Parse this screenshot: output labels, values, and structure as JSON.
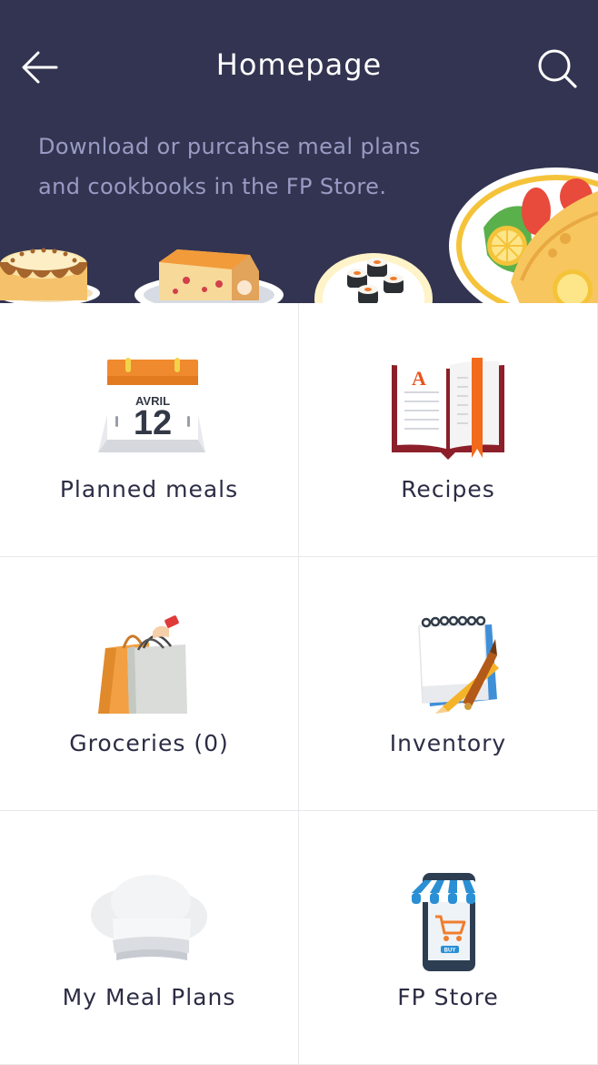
{
  "header": {
    "title": "Homepage",
    "promo_text": "Download or purcahse meal plans and cookbooks in the FP Store.",
    "background_color": "#333451",
    "back_icon": "arrow-left-icon",
    "search_icon": "search-icon"
  },
  "tiles": [
    {
      "label": "Planned meals",
      "icon": "calendar-icon",
      "calendar_month": "AVRIL",
      "calendar_day": "12"
    },
    {
      "label": "Recipes",
      "icon": "recipe-book-icon",
      "book_letter": "A"
    },
    {
      "label": "Groceries (0)",
      "icon": "shopping-bags-icon"
    },
    {
      "label": "Inventory",
      "icon": "notepad-icon"
    },
    {
      "label": "My Meal Plans",
      "icon": "chef-hat-icon"
    },
    {
      "label": "FP Store",
      "icon": "mobile-store-icon",
      "store_badge": "BUY"
    }
  ],
  "colors": {
    "accent_orange": "#f07d2d",
    "text_dark": "#2c2c45",
    "promo_text": "#9a9bc4"
  }
}
